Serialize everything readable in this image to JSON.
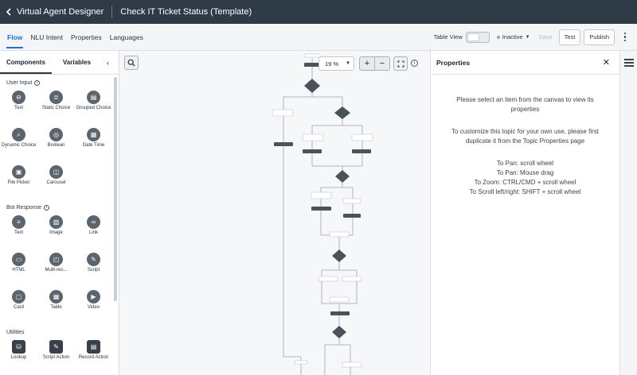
{
  "topbar": {
    "app_title": "Virtual Agent Designer",
    "doc_title": "Check IT Ticket Status (Template)"
  },
  "tabs": [
    {
      "label": "Flow",
      "active": true
    },
    {
      "label": "NLU Intent"
    },
    {
      "label": "Properties"
    },
    {
      "label": "Languages"
    }
  ],
  "toolbar": {
    "table_view_label": "Table View",
    "status_label": "Inactive",
    "save_label": "Save",
    "test_label": "Test",
    "publish_label": "Publish"
  },
  "left_panel": {
    "tabs": [
      "Components",
      "Variables"
    ],
    "user_input": {
      "title": "User Input",
      "items": [
        "Text",
        "Static Choice",
        "Grouped Choice",
        "Dynamic Choice",
        "Boolean",
        "Date Time",
        "File Picker",
        "Carousel"
      ]
    },
    "bot_response": {
      "title": "Bot Response",
      "items": [
        "Text",
        "Image",
        "Link",
        "HTML",
        "Multi-res...",
        "Script",
        "Card",
        "Table",
        "Video"
      ]
    },
    "utilities": {
      "title": "Utilities",
      "items": [
        "Lookup",
        "Script Action",
        "Record Action"
      ]
    }
  },
  "canvas": {
    "zoom": "19 %"
  },
  "properties_panel": {
    "title": "Properties",
    "message1": "Please select an item from the canvas to view its properties",
    "message2": "To customize this topic for your own use, please first duplicate it from the Topic Properties page",
    "hints": [
      "To Pan: scroll wheel",
      "To Pan: Mouse drag",
      "To Zoom: CTRL/CMD + scroll wheel",
      "To Scroll left/right: SHIFT + scroll wheel"
    ]
  },
  "colors": {
    "topbar": "#2e3a46",
    "accent": "#1f6fcf"
  }
}
